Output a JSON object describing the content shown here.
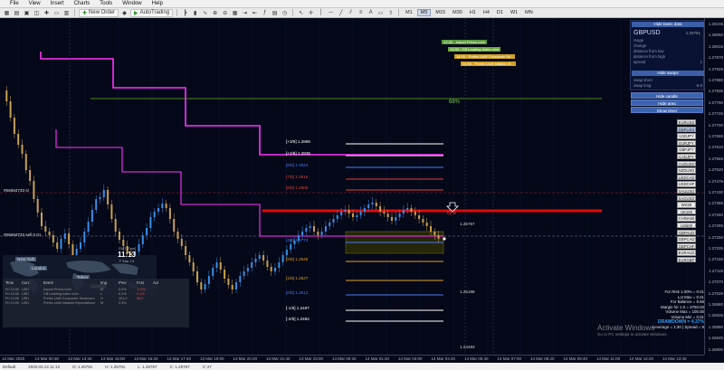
{
  "menu": [
    "File",
    "View",
    "Insert",
    "Charts",
    "Tools",
    "Window",
    "Help"
  ],
  "toolbar": {
    "new_order": "New Order",
    "autotrading": "AutoTrading",
    "timeframes": [
      "M1",
      "M5",
      "M15",
      "M30",
      "H1",
      "H4",
      "D1",
      "W1",
      "MN"
    ],
    "active_timeframe": "M5"
  },
  "side_panel": {
    "hide_basic": "Hide basic data",
    "symbol": "GBPUSD",
    "price": "1.25791",
    "rows": [
      {
        "label": "range",
        "value": ""
      },
      {
        "label": "change",
        "value": ""
      },
      {
        "label": "distance from low",
        "value": ""
      },
      {
        "label": "distance from high",
        "value": ""
      },
      {
        "label": "spread",
        "value": "1"
      }
    ],
    "hide_swaps": "Hide swaps",
    "swap_short": {
      "label": "swap short",
      "value": ""
    },
    "swap_long": {
      "label": "swap long",
      "value": "-8.9"
    },
    "hide_candle": "Hide candle",
    "hide_area": "Hide area",
    "show_timer": "Show timer"
  },
  "symbols": [
    "EURUSD",
    "GBPUSD",
    "USDJPY",
    "EURJPY",
    "GBPJPY",
    "CADJPY",
    "AUDUSD",
    "NZDUSD",
    "USDCAD",
    "USDCHF",
    "XAUUSD",
    "XAGUSD",
    "WS30",
    "UK100",
    "CHINA50",
    "US500",
    "GBPAUD",
    "GBPCAD",
    "GBPCHF",
    "EURAUD",
    "EURGBP"
  ],
  "active_symbol": "GBPUSD",
  "news_tags": [
    "12:30 - Import Prices m/m",
    "13:30 - CB Leading Index m/m",
    "14:00 - Prelim UoM Consumer Se...",
    "14:00 - Prelim UoM Inflation E..."
  ],
  "levels": [
    {
      "label": "[+3/8]",
      "value": "1.2865",
      "color": "#ffffff"
    },
    {
      "label": "[+2/8]",
      "value": "1.2836",
      "color": "#ffffff"
    },
    {
      "label": "[8/8]",
      "value": "1.2824",
      "color": "#4a7cf0"
    },
    {
      "label": "[7/8]",
      "value": "1.2815",
      "color": "#e04040"
    },
    {
      "label": "[6/8]",
      "value": "1.2806",
      "color": "#e04040"
    },
    {
      "label": "[4/8]",
      "value": "1.2773",
      "color": "#4a7cf0"
    },
    {
      "label": "[2/8]",
      "value": "1.2545",
      "color": "#e0a030"
    },
    {
      "label": "[1/8]",
      "value": "1.2527",
      "color": "#e0a030"
    },
    {
      "label": "[0/8]",
      "value": "1.2512",
      "color": "#4a7cf0"
    },
    {
      "label": "[-1/8]",
      "value": "1.2497",
      "color": "#ffffff"
    },
    {
      "label": "[-2/8]",
      "value": "1.2482",
      "color": "#ffffff"
    }
  ],
  "chart_labels": {
    "pct": "68%",
    "pct2": "62%",
    "price_right1": "1.25767",
    "price_right2": "1.25198",
    "price_right3": "1.24483",
    "left_tag1": "#56684733 sl",
    "left_tag2": "#56684733 sell 0.01"
  },
  "price_ticks": [
    "1.28105",
    "1.28060",
    "1.28015",
    "1.27970",
    "1.27925",
    "1.27880",
    "1.27835",
    "1.27790",
    "1.27745",
    "1.27700",
    "1.27655",
    "1.27610",
    "1.27565",
    "1.27520",
    "1.27475",
    "1.27430",
    "1.27385",
    "1.27340",
    "1.27295",
    "1.27250",
    "1.27205",
    "1.27160",
    "1.27115",
    "1.27070",
    "1.27025",
    "1.26980",
    "1.26935",
    "1.26890",
    "1.26845",
    "1.26800"
  ],
  "time_ticks": [
    "12 Mar 2020",
    "13 Mar 00:30",
    "13 Mar 13:40",
    "13 Mar 15:00",
    "13 Mar 16:20",
    "13 Mar 17:40",
    "13 Mar 19:00",
    "13 Mar 20:20",
    "13 Mar 21:40",
    "13 Mar 23:00",
    "14 Mar 00:20",
    "14 Mar 01:40",
    "14 Mar 03:00",
    "14 Mar 04:20",
    "14 Mar 05:40",
    "14 Mar 07:00",
    "14 Mar 08:20",
    "14 Mar 09:40",
    "14 Mar 11:00",
    "14 Mar 12:20",
    "14 Mar 13:40"
  ],
  "clock": {
    "caption": "GMT Time",
    "time": "11:13",
    "day": "F Mar 13"
  },
  "map_regions": [
    "New York",
    "London",
    "Tokyo",
    "Sydney"
  ],
  "news_table": {
    "headers": [
      "Time",
      "Curr.",
      "Event",
      "Imp.",
      "Prev",
      "Fcst",
      "Act"
    ],
    "rows": [
      [
        "Fri 12:30",
        "USD",
        "Import Prices m/m",
        "M",
        "0.0%",
        "-0.9%",
        ""
      ],
      [
        "Fri 13:30",
        "USD",
        "CB Leading Index m/m",
        "L",
        "0.1%",
        "0.1%",
        ""
      ],
      [
        "Fri 14:00",
        "USD",
        "Prelim UoM Consumer Sentiment",
        "H",
        "101.0",
        "98.0",
        ""
      ],
      [
        "Fri 14:00",
        "USD",
        "Prelim UoM Inflation Expectations",
        "M",
        "2.3%",
        "",
        ""
      ]
    ]
  },
  "stats": [
    "For Risk 1.00% = 0.01",
    "Lot Max = 0.01",
    "For Balance = 9.58",
    "Margin for 1.0 = 3750.03",
    "Volume Max = 100.00",
    "Volume Min = 0.01",
    "DRAWDOWN = 4.37%",
    "Leverage = 1:30 | Spread = 9"
  ],
  "watermark": {
    "title": "Activate Windows",
    "subtitle": "Go to PC settings to activate Windows."
  },
  "statusbar": [
    "Default",
    "2020.03.13 11:13",
    "O: 1.25791",
    "H: 1.25791",
    "L: 1.25767",
    "C: 1.25767",
    "V: 27"
  ],
  "colors": {
    "magenta": "#ff33ff",
    "red": "#e10a0a",
    "green_line": "#60b020",
    "candle": "#3a8ee6",
    "candle_up": "#c8a050",
    "panel_blue": "#3c5fa8"
  }
}
